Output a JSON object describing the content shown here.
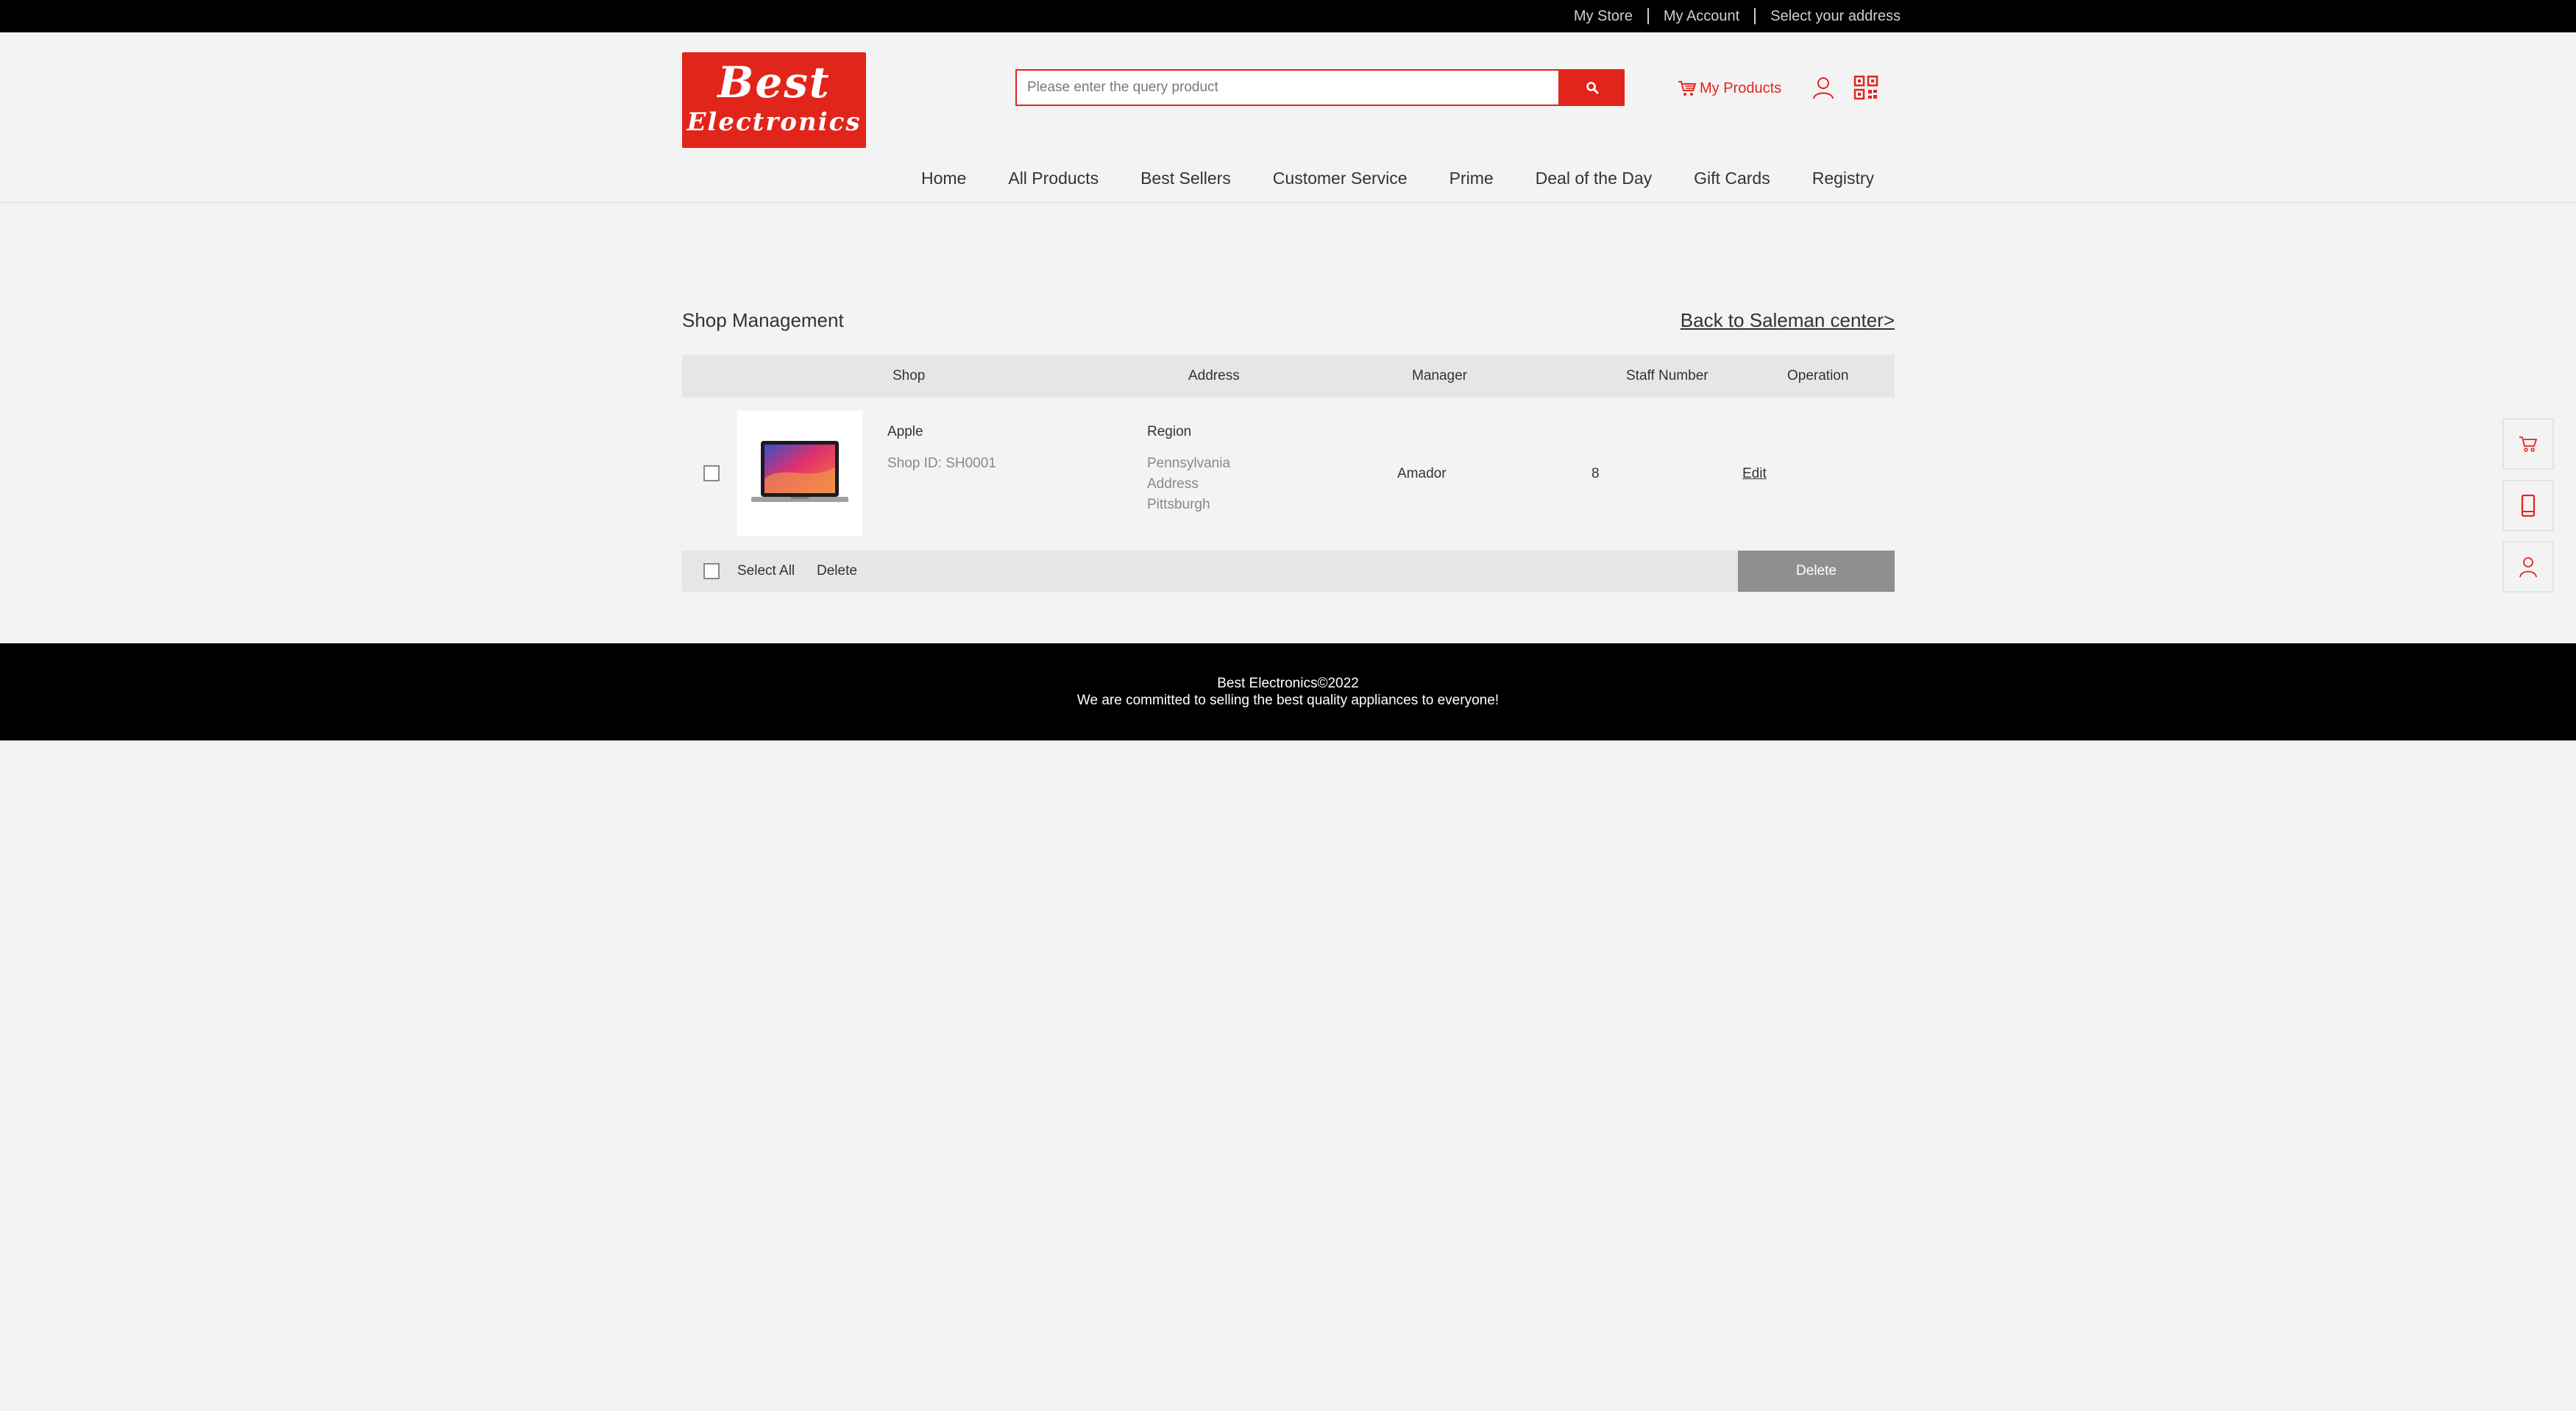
{
  "topbar": {
    "my_store": "My Store",
    "my_account": "My Account",
    "select_address": "Select your address"
  },
  "header": {
    "logo_line1": "Best",
    "logo_line2": "Electronics",
    "search_placeholder": "Please enter the query product",
    "search_icon": "search-icon",
    "my_products": "My Products",
    "icons": [
      "cart-icon",
      "user-icon",
      "qr-code-icon"
    ]
  },
  "nav": {
    "items": [
      "Home",
      "All Products",
      "Best Sellers",
      "Customer Service",
      "Prime",
      "Deal of the Day",
      "Gift Cards",
      "Registry"
    ]
  },
  "main": {
    "title": "Shop Management",
    "back_link": "Back to Saleman center>",
    "columns": [
      "Shop",
      "Address",
      "Manager",
      "Staff Number",
      "Operation"
    ],
    "rows": [
      {
        "shop_name": "Apple",
        "shop_id": "Shop ID: SH0001",
        "region_label": "Region",
        "address_lines": [
          "Pennsylvania",
          "Address",
          "Pittsburgh"
        ],
        "manager": "Amador",
        "staff_number": "8",
        "operation": "Edit"
      }
    ],
    "footer_bar": {
      "select_all": "Select All",
      "delete_link": "Delete",
      "delete_button": "Delete"
    }
  },
  "footer": {
    "line1": "Best Electronics©2022",
    "line2": "We are committed to selling the best quality appliances to everyone!"
  },
  "side_tools": [
    "cart-icon",
    "phone-icon",
    "user-icon"
  ],
  "colors": {
    "accent": "#e1251b",
    "topbar": "#000000",
    "background": "#f4f3f3",
    "table_header": "#e6e6e6",
    "delete_button": "#8f8f8f"
  }
}
